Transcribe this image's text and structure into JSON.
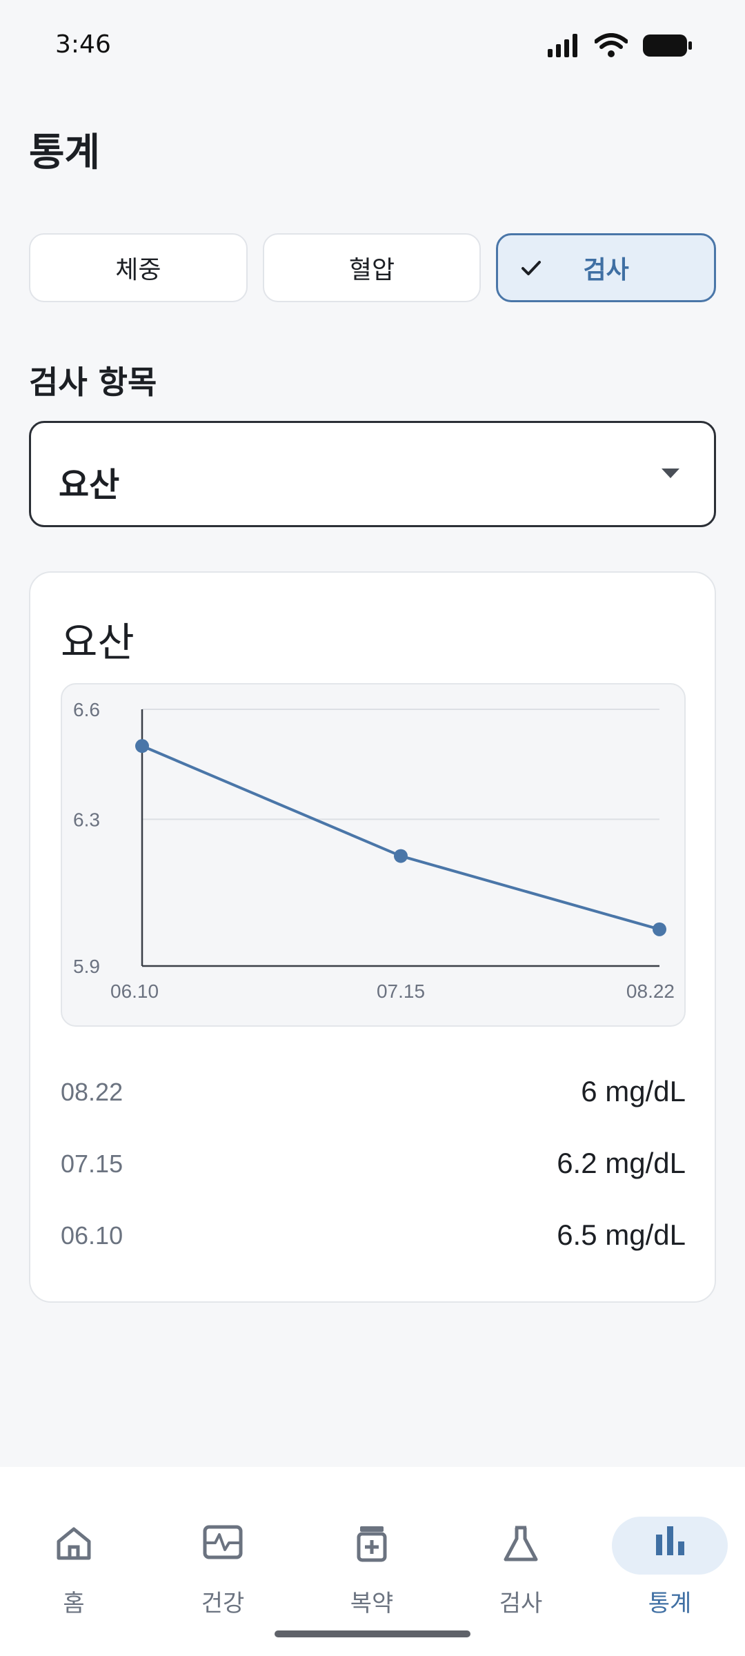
{
  "status_bar": {
    "time": "3:46"
  },
  "header": {
    "title": "통계"
  },
  "segments": [
    {
      "label": "체중",
      "active": false
    },
    {
      "label": "혈압",
      "active": false
    },
    {
      "label": "검사",
      "active": true
    }
  ],
  "test_item": {
    "label": "검사 항목",
    "selected": "요산"
  },
  "card": {
    "title": "요산",
    "records": [
      {
        "date": "08.22",
        "value": "6 mg/dL"
      },
      {
        "date": "07.15",
        "value": "6.2 mg/dL"
      },
      {
        "date": "06.10",
        "value": "6.5 mg/dL"
      }
    ]
  },
  "chart_data": {
    "type": "line",
    "x": [
      "06.10",
      "07.15",
      "08.22"
    ],
    "series": [
      {
        "values": [
          6.5,
          6.2,
          6.0
        ]
      }
    ],
    "yticks": [
      "6.6",
      "6.3",
      "5.9"
    ],
    "ylim": [
      5.9,
      6.6
    ],
    "grid": true,
    "color": "#4a76a8"
  },
  "nav": {
    "items": [
      {
        "label": "홈",
        "icon": "home-icon",
        "active": false
      },
      {
        "label": "건강",
        "icon": "health-monitor-icon",
        "active": false
      },
      {
        "label": "복약",
        "icon": "medication-icon",
        "active": false
      },
      {
        "label": "검사",
        "icon": "flask-icon",
        "active": false
      },
      {
        "label": "통계",
        "icon": "bar-chart-icon",
        "active": true
      }
    ]
  },
  "colors": {
    "accent": "#4a76a8",
    "accent_bg": "#e5eef8",
    "background": "#f6f7f9"
  }
}
